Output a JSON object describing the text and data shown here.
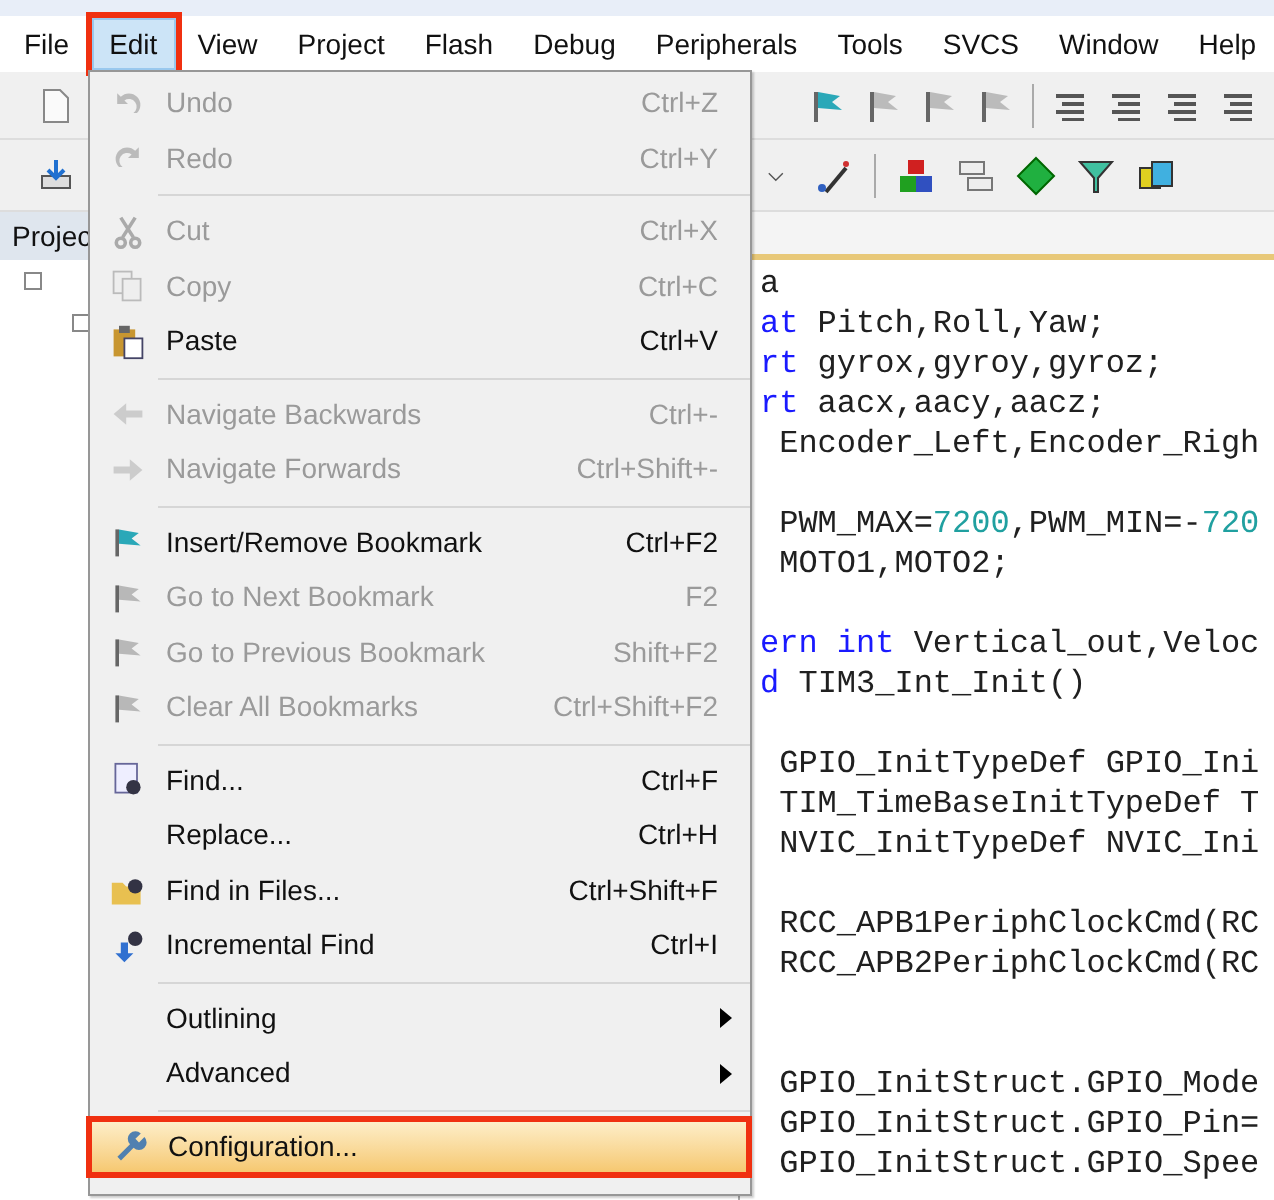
{
  "menubar": [
    {
      "label": "File",
      "selected": false,
      "annotated": false
    },
    {
      "label": "Edit",
      "selected": true,
      "annotated": true
    },
    {
      "label": "View",
      "selected": false,
      "annotated": false
    },
    {
      "label": "Project",
      "selected": false,
      "annotated": false
    },
    {
      "label": "Flash",
      "selected": false,
      "annotated": false
    },
    {
      "label": "Debug",
      "selected": false,
      "annotated": false
    },
    {
      "label": "Peripherals",
      "selected": false,
      "annotated": false
    },
    {
      "label": "Tools",
      "selected": false,
      "annotated": false
    },
    {
      "label": "SVCS",
      "selected": false,
      "annotated": false
    },
    {
      "label": "Window",
      "selected": false,
      "annotated": false
    },
    {
      "label": "Help",
      "selected": false,
      "annotated": false
    }
  ],
  "project_panel": {
    "title": "Projec"
  },
  "edit_menu": {
    "groups": [
      [
        {
          "label": "Undo",
          "shortcut": "Ctrl+Z",
          "disabled": true,
          "submenu": false,
          "selected": false,
          "annotated": false
        },
        {
          "label": "Redo",
          "shortcut": "Ctrl+Y",
          "disabled": true,
          "submenu": false,
          "selected": false,
          "annotated": false
        }
      ],
      [
        {
          "label": "Cut",
          "shortcut": "Ctrl+X",
          "disabled": true,
          "submenu": false,
          "selected": false,
          "annotated": false
        },
        {
          "label": "Copy",
          "shortcut": "Ctrl+C",
          "disabled": true,
          "submenu": false,
          "selected": false,
          "annotated": false
        },
        {
          "label": "Paste",
          "shortcut": "Ctrl+V",
          "disabled": false,
          "submenu": false,
          "selected": false,
          "annotated": false
        }
      ],
      [
        {
          "label": "Navigate Backwards",
          "shortcut": "Ctrl+-",
          "disabled": true,
          "submenu": false,
          "selected": false,
          "annotated": false
        },
        {
          "label": "Navigate Forwards",
          "shortcut": "Ctrl+Shift+-",
          "disabled": true,
          "submenu": false,
          "selected": false,
          "annotated": false
        }
      ],
      [
        {
          "label": "Insert/Remove Bookmark",
          "shortcut": "Ctrl+F2",
          "disabled": false,
          "submenu": false,
          "selected": false,
          "annotated": false
        },
        {
          "label": "Go to Next Bookmark",
          "shortcut": "F2",
          "disabled": true,
          "submenu": false,
          "selected": false,
          "annotated": false
        },
        {
          "label": "Go to Previous Bookmark",
          "shortcut": "Shift+F2",
          "disabled": true,
          "submenu": false,
          "selected": false,
          "annotated": false
        },
        {
          "label": "Clear All Bookmarks",
          "shortcut": "Ctrl+Shift+F2",
          "disabled": true,
          "submenu": false,
          "selected": false,
          "annotated": false
        }
      ],
      [
        {
          "label": "Find...",
          "shortcut": "Ctrl+F",
          "disabled": false,
          "submenu": false,
          "selected": false,
          "annotated": false
        },
        {
          "label": "Replace...",
          "shortcut": "Ctrl+H",
          "disabled": false,
          "submenu": false,
          "selected": false,
          "annotated": false
        },
        {
          "label": "Find in Files...",
          "shortcut": "Ctrl+Shift+F",
          "disabled": false,
          "submenu": false,
          "selected": false,
          "annotated": false
        },
        {
          "label": "Incremental Find",
          "shortcut": "Ctrl+I",
          "disabled": false,
          "submenu": false,
          "selected": false,
          "annotated": false
        }
      ],
      [
        {
          "label": "Outlining",
          "disabled": false,
          "submenu": true,
          "selected": false,
          "annotated": false
        },
        {
          "label": "Advanced",
          "disabled": false,
          "submenu": true,
          "selected": false,
          "annotated": false
        }
      ],
      [
        {
          "label": "Configuration...",
          "disabled": false,
          "submenu": false,
          "selected": true,
          "annotated": true
        }
      ]
    ]
  },
  "editor": {
    "lines": [
      {
        "kind": "code",
        "segments": [
          {
            "text": "a",
            "kind": "plain"
          }
        ]
      },
      {
        "kind": "code",
        "segments": [
          {
            "text": "at",
            "kind": "keyword"
          },
          {
            "text": " Pitch,Roll,Yaw;",
            "kind": "plain"
          }
        ]
      },
      {
        "kind": "code",
        "segments": [
          {
            "text": "rt",
            "kind": "keyword"
          },
          {
            "text": " gyrox,gyroy,gyroz;",
            "kind": "plain"
          }
        ]
      },
      {
        "kind": "code",
        "segments": [
          {
            "text": "rt",
            "kind": "keyword"
          },
          {
            "text": " aacx,aacy,aacz;",
            "kind": "plain"
          }
        ]
      },
      {
        "kind": "code",
        "segments": [
          {
            "text": " Encoder_Left,Encoder_Righ",
            "kind": "plain"
          }
        ]
      },
      {
        "kind": "blank"
      },
      {
        "kind": "code",
        "segments": [
          {
            "text": " PWM_MAX=",
            "kind": "plain"
          },
          {
            "text": "7200",
            "kind": "number"
          },
          {
            "text": ",PWM_MIN=-",
            "kind": "plain"
          },
          {
            "text": "720",
            "kind": "number"
          }
        ]
      },
      {
        "kind": "code",
        "segments": [
          {
            "text": " MOTO1,MOTO2;",
            "kind": "plain"
          }
        ]
      },
      {
        "kind": "blank"
      },
      {
        "kind": "code",
        "segments": [
          {
            "text": "ern int",
            "kind": "keyword"
          },
          {
            "text": " Vertical_out,Veloc",
            "kind": "plain"
          }
        ]
      },
      {
        "kind": "code",
        "segments": [
          {
            "text": "d",
            "kind": "keyword"
          },
          {
            "text": " TIM3_Int_Init()",
            "kind": "plain"
          }
        ]
      },
      {
        "kind": "blank"
      },
      {
        "kind": "code",
        "segments": [
          {
            "text": " GPIO_InitTypeDef GPIO_Ini",
            "kind": "plain"
          }
        ]
      },
      {
        "kind": "code",
        "segments": [
          {
            "text": " TIM_TimeBaseInitTypeDef T",
            "kind": "plain"
          }
        ]
      },
      {
        "kind": "code",
        "segments": [
          {
            "text": " NVIC_InitTypeDef NVIC_Ini",
            "kind": "plain"
          }
        ]
      },
      {
        "kind": "blank"
      },
      {
        "kind": "code",
        "segments": [
          {
            "text": " RCC_APB1PeriphClockCmd(RC",
            "kind": "plain"
          }
        ]
      },
      {
        "kind": "code",
        "segments": [
          {
            "text": " RCC_APB2PeriphClockCmd(RC",
            "kind": "plain"
          }
        ]
      },
      {
        "kind": "blank"
      },
      {
        "kind": "blank"
      },
      {
        "kind": "code",
        "segments": [
          {
            "text": " GPIO_InitStruct.GPIO_Mode",
            "kind": "plain"
          }
        ]
      },
      {
        "kind": "code",
        "segments": [
          {
            "text": " GPIO_InitStruct.GPIO_Pin=",
            "kind": "plain"
          }
        ]
      },
      {
        "kind": "code",
        "segments": [
          {
            "text": " GPIO_InitStruct.GPIO_Spee",
            "kind": "plain"
          }
        ]
      }
    ]
  }
}
